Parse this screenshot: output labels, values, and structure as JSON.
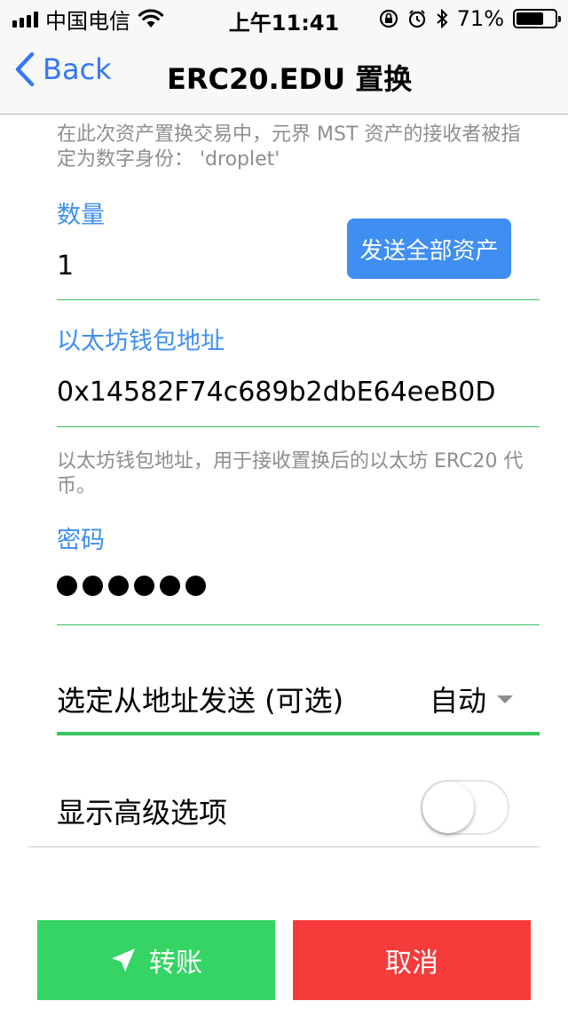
{
  "status_bar": {
    "carrier": "中国电信",
    "time": "上午11:41",
    "battery": "71%"
  },
  "nav": {
    "back_label": "Back",
    "title": "ERC20.EDU 置换"
  },
  "form": {
    "receiver_hint": "在此次资产置换交易中，元界 MST 资产的接收者被指定为数字身份： 'droplet'",
    "amount_label": "数量",
    "amount_value": "1",
    "send_all_label": "发送全部资产",
    "eth_address_label": "以太坊钱包地址",
    "eth_address_value": "0x14582F74c689b2dbE64eeB0D",
    "eth_address_hint": "以太坊钱包地址，用于接收置换后的以太坊 ERC20 代币。",
    "password_label": "密码",
    "password_dots": 6,
    "from_address_label": "选定从地址发送 (可选)",
    "from_address_value": "自动",
    "advanced_label": "显示高级选项",
    "advanced_enabled": false
  },
  "actions": {
    "transfer_label": "转账",
    "cancel_label": "取消"
  },
  "colors": {
    "accent": "#3f8ef2",
    "ios_blue": "#3478f6",
    "green": "#35d464",
    "underline_green": "#37c45e",
    "red": "#f63b3b",
    "hint_gray": "#8e8e8e"
  },
  "icons": {
    "back": "chevron-left-icon",
    "transfer": "paper-plane-icon",
    "dropdown": "caret-down-icon"
  }
}
